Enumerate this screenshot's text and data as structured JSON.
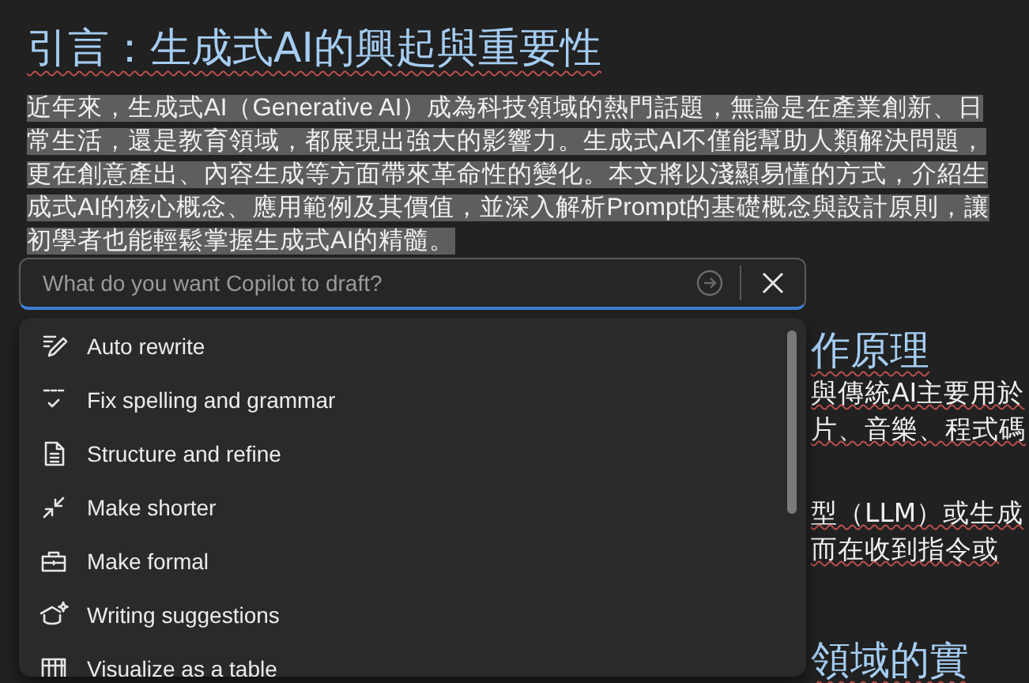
{
  "document": {
    "heading": "引言：生成式AI的興起與重要性",
    "paragraph": "近年來，生成式AI（Generative AI）成為科技領域的熱門話題，無論是在產業創新、日常生活，還是教育領域，都展現出強大的影響力。生成式AI不僅能幫助人類解決問題，更在創意產出、內容生成等方面帶來革命性的變化。本文將以淺顯易懂的方式，介紹生成式AI的核心概念、應用範例及其價值，並深入解析Prompt的基礎概念與設計原則，讓初學者也能輕鬆掌握生成式AI的精髓。",
    "paragraph_selected": true,
    "partial_heading": "作原理",
    "partial_paragraphs": [
      [
        "與傳統AI主要用於",
        "片、音樂、程式碼"
      ],
      [
        "型（LLM）或生成",
        "而在收到指令或"
      ]
    ],
    "partial_heading_2": "領域的實"
  },
  "copilot": {
    "prompt": {
      "placeholder": "What do you want Copilot to draft?",
      "focused": true
    },
    "menu": [
      {
        "kind": "pen",
        "label": "Auto rewrite"
      },
      {
        "kind": "abc",
        "label": "Fix spelling and grammar"
      },
      {
        "kind": "document",
        "label": "Structure and refine"
      },
      {
        "kind": "shrink",
        "label": "Make shorter"
      },
      {
        "kind": "briefcase",
        "label": "Make formal"
      },
      {
        "kind": "cap",
        "label": "Writing suggestions"
      },
      {
        "kind": "table",
        "label": "Visualize as a table"
      }
    ]
  }
}
